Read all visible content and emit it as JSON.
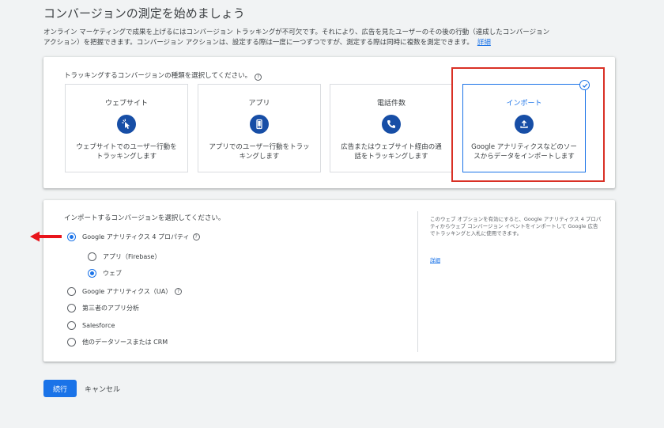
{
  "header": {
    "title": "コンバージョンの測定を始めましょう",
    "intro_line1": "オンライン マーケティングで成果を上げるにはコンバージョン トラッキングが不可欠です。それにより、広告を見たユーザーのその後の行動（達成したコンバージョン",
    "intro_line2": "アクション）を把握できます。コンバージョン アクションは、設定する際は一度に一つずつですが、測定する際は同時に複数を測定できます。",
    "details_link": "詳細"
  },
  "tracking": {
    "prompt": "トラッキングするコンバージョンの種類を選択してください。",
    "help_icon": "?",
    "tiles": [
      {
        "title": "ウェブサイト",
        "icon": "cursor-click-icon",
        "desc": "ウェブサイトでのユーザー行動をトラッキングします"
      },
      {
        "title": "アプリ",
        "icon": "phone-icon",
        "desc": "アプリでのユーザー行動をトラッキングします"
      },
      {
        "title": "電話件数",
        "icon": "call-icon",
        "desc": "広告またはウェブサイト経由の通話をトラッキングします"
      },
      {
        "title": "インポート",
        "icon": "upload-icon",
        "desc": "Google アナリティクスなどのソースからデータをインポートします"
      }
    ],
    "selected_tile": "インポート"
  },
  "import": {
    "prompt": "インポートするコンバージョンを選択してください。",
    "options": [
      {
        "label": "Google アナリティクス 4 プロパティ",
        "selected": true,
        "help": "?"
      },
      {
        "label": "アプリ（Firebase）",
        "selected": false
      },
      {
        "label": "ウェブ",
        "selected": true
      },
      {
        "label": "Google アナリティクス（UA）",
        "selected": false,
        "help": "?"
      },
      {
        "label": "第三者のアプリ分析",
        "selected": false
      },
      {
        "label": "Salesforce",
        "selected": false
      },
      {
        "label": "他のデータソースまたは CRM",
        "selected": false
      }
    ],
    "side_note": "このウェブ オプションを有効にすると、Google アナリティクス 4 プロパティからウェブ コンバージョン イベントをインポートして Google 広告でトラッキングと入札に使用できます。",
    "side_link": "詳細"
  },
  "footer": {
    "continue_label": "続行",
    "cancel_label": "キャンセル"
  },
  "colors": {
    "accent": "#1a73e8",
    "icon_bg": "#174ea6",
    "highlight_red": "#d93025"
  }
}
